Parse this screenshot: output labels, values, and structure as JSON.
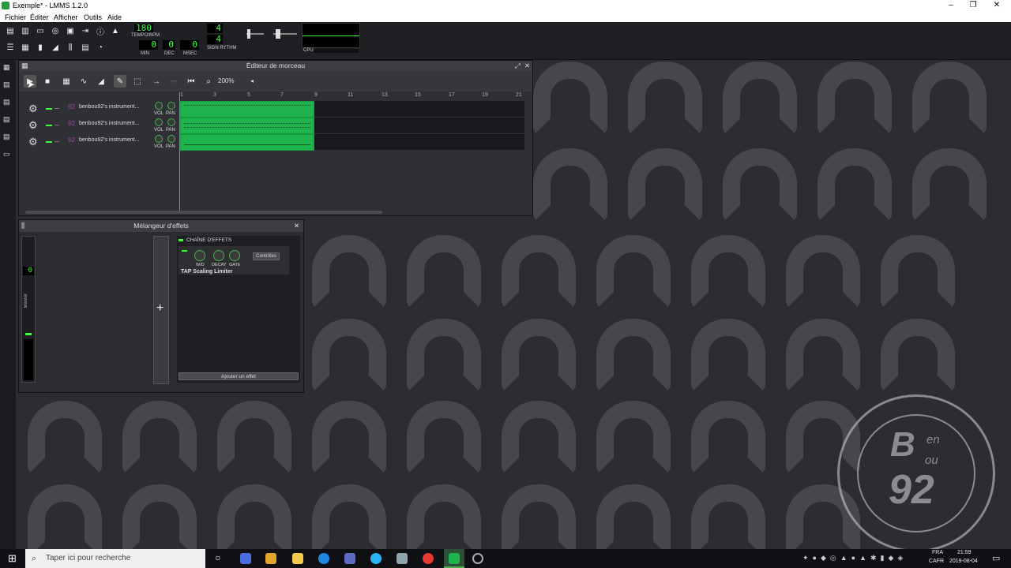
{
  "window": {
    "title": "Exemple* - LMMS 1.2.0",
    "controls": [
      "minimize",
      "restore",
      "close"
    ]
  },
  "menu": [
    "Fichier",
    "Éditer",
    "Afficher",
    "Outils",
    "Aide"
  ],
  "toolbar": {
    "tempo": {
      "value": "180",
      "label": "TEMPO/BPM"
    },
    "time": {
      "min": "0",
      "dec": "0",
      "msec": "0",
      "labels": [
        "MIN",
        "DEC",
        "MSEC"
      ]
    },
    "signature": {
      "num": "4",
      "den": "4",
      "label": "SIGN RYTHM"
    },
    "cpu_label": "CPU"
  },
  "song_editor": {
    "title": "Éditeur de morceau",
    "zoom": "200%",
    "bar_numbers": [
      "1",
      "3",
      "5",
      "7",
      "9",
      "11",
      "13",
      "15",
      "17",
      "19",
      "21"
    ],
    "tracks": [
      {
        "name": "benbou92's instrument..."
      },
      {
        "name": "benbou92's instrument..."
      },
      {
        "name": "benbou92's instrument..."
      }
    ],
    "knob_labels": {
      "vol": "VOL",
      "pan": "PAN"
    }
  },
  "mixer": {
    "title": "Mélangeur d'effets",
    "channel_name": "Master",
    "channel_value": "0",
    "add_channel": "+",
    "effect_chain_label": "CHAÎNE D'EFFETS",
    "effect": {
      "name": "TAP Scaling Limiter",
      "knob_labels": [
        "W/D",
        "DECAY",
        "GATE"
      ],
      "controls_button": "Contrôles"
    },
    "add_effect_button": "Ajouter un effet"
  },
  "taskbar": {
    "search_placeholder": "Taper ici pour recherche",
    "lang": "FRA",
    "layout": "CAFR",
    "time": "21:59",
    "date": "2019-08-04"
  },
  "watermark": {
    "line1": "B",
    "line2": "en",
    "line3": "ou",
    "line4": "92"
  },
  "colors": {
    "accent": "#1fb34d",
    "lcd_text": "#3cff3c",
    "background": "#2b2d31"
  }
}
